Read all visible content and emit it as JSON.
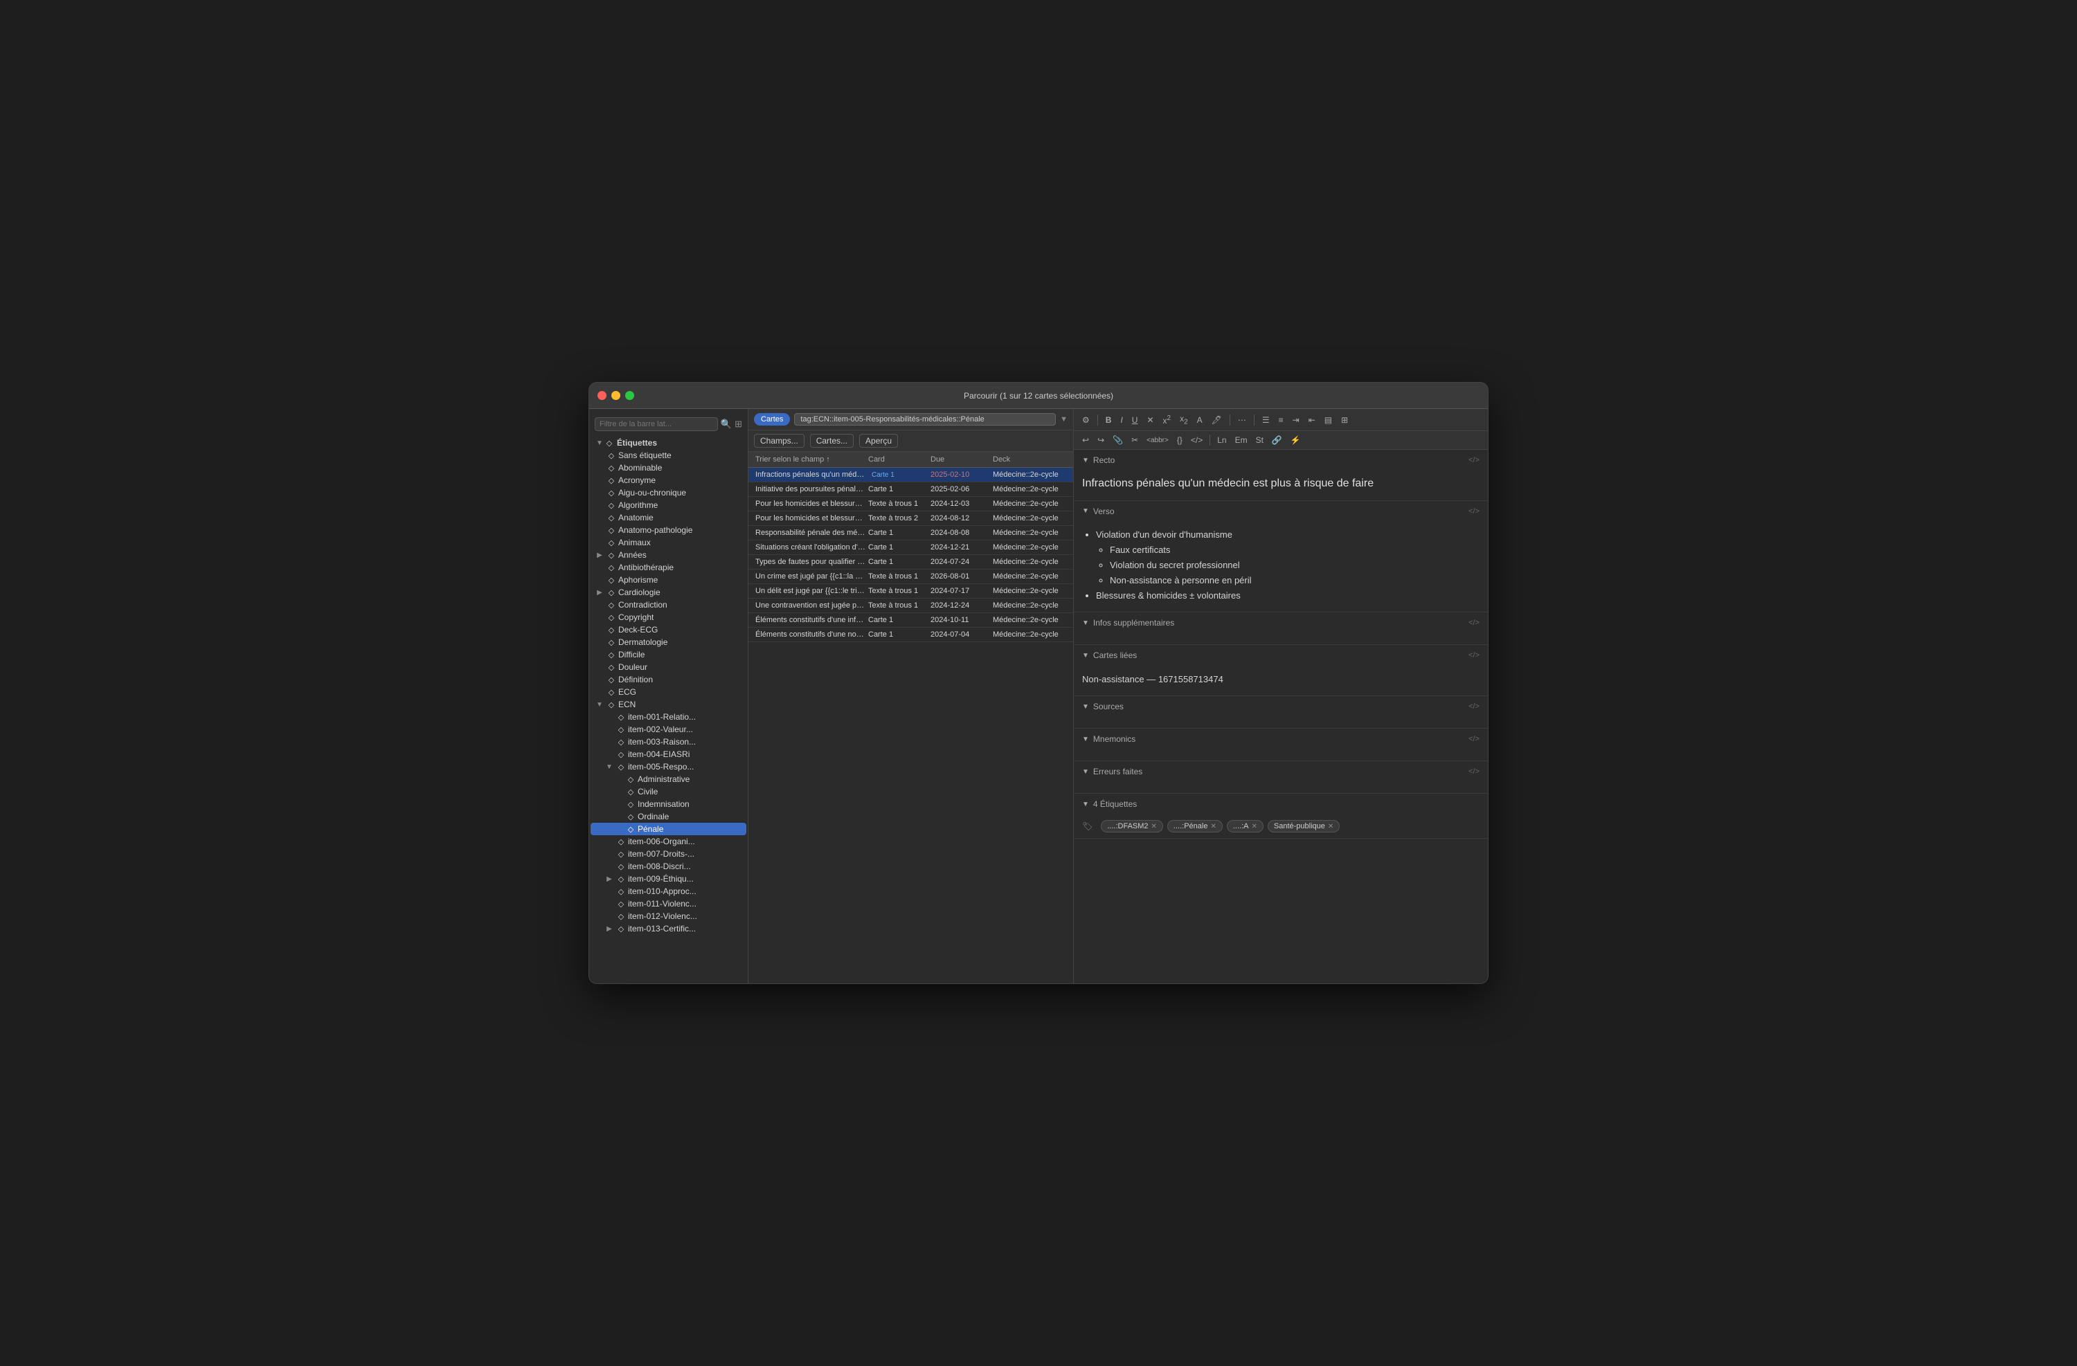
{
  "window": {
    "title": "Parcourir (1 sur 12 cartes sélectionnées)"
  },
  "toolbar": {
    "filter_placeholder": "Filtre de la barre lat...",
    "cards_btn": "Cartes",
    "tag_filter": "tag:ECN::item-005-Responsabilités-médicales::Pénale",
    "champs_btn": "Champs...",
    "cartes_btn": "Cartes...",
    "apercu_btn": "Aperçu"
  },
  "table": {
    "headers": [
      "Trier selon le champ",
      "Card",
      "Due",
      "Deck"
    ],
    "rows": [
      {
        "title": "Infractions pénales qu'un médeci...",
        "card": "Carte 1",
        "due": "2025-02-10",
        "deck": "Médecine::2e-cycle",
        "selected": true
      },
      {
        "title": "Initiative des poursuites pénales ...",
        "card": "Carte 1",
        "due": "2025-02-06",
        "deck": "Médecine::2e-cycle",
        "selected": false
      },
      {
        "title": "Pour les homicides et blessures i...",
        "card": "Texte à trous 1",
        "due": "2024-12-03",
        "deck": "Médecine::2e-cycle",
        "selected": false
      },
      {
        "title": "Pour les homicides et blessures i...",
        "card": "Texte à trous 2",
        "due": "2024-08-12",
        "deck": "Médecine::2e-cycle",
        "selected": false
      },
      {
        "title": "Responsabilité pénale des méde...",
        "card": "Carte 1",
        "due": "2024-08-08",
        "deck": "Médecine::2e-cycle",
        "selected": false
      },
      {
        "title": "Situations créant l'obligation d'as...",
        "card": "Carte 1",
        "due": "2024-12-21",
        "deck": "Médecine::2e-cycle",
        "selected": false
      },
      {
        "title": "Types de fautes pour qualifier un...",
        "card": "Carte 1",
        "due": "2024-07-24",
        "deck": "Médecine::2e-cycle",
        "selected": false
      },
      {
        "title": "Un crime est jugé par {{c1::la cou...",
        "card": "Texte à trous 1",
        "due": "2026-08-01",
        "deck": "Médecine::2e-cycle",
        "selected": false
      },
      {
        "title": "Un délit est jugé par {{c1::le tribu...",
        "card": "Texte à trous 1",
        "due": "2024-07-17",
        "deck": "Médecine::2e-cycle",
        "selected": false
      },
      {
        "title": "Une contravention est jugée par ...",
        "card": "Texte à trous 1",
        "due": "2024-12-24",
        "deck": "Médecine::2e-cycle",
        "selected": false
      },
      {
        "title": "Éléments constitutifs d'une infrac...",
        "card": "Carte 1",
        "due": "2024-10-11",
        "deck": "Médecine::2e-cycle",
        "selected": false
      },
      {
        "title": "Éléments constitutifs d'une non-a...",
        "card": "Carte 1",
        "due": "2024-07-04",
        "deck": "Médecine::2e-cycle",
        "selected": false
      }
    ]
  },
  "sidebar": {
    "filter_placeholder": "Filtre de la barre lat...",
    "root_label": "Étiquettes",
    "items": [
      {
        "label": "Sans étiquette",
        "depth": 1,
        "arrow": "",
        "icon": "◇"
      },
      {
        "label": "Abominable",
        "depth": 1,
        "arrow": "",
        "icon": "◇"
      },
      {
        "label": "Acronyme",
        "depth": 1,
        "arrow": "",
        "icon": "◇"
      },
      {
        "label": "Aigu-ou-chronique",
        "depth": 1,
        "arrow": "",
        "icon": "◇"
      },
      {
        "label": "Algorithme",
        "depth": 1,
        "arrow": "",
        "icon": "◇"
      },
      {
        "label": "Anatomie",
        "depth": 1,
        "arrow": "",
        "icon": "◇"
      },
      {
        "label": "Anatomo-pathologie",
        "depth": 1,
        "arrow": "",
        "icon": "◇"
      },
      {
        "label": "Animaux",
        "depth": 1,
        "arrow": "",
        "icon": "◇"
      },
      {
        "label": "Années",
        "depth": 1,
        "arrow": "▶",
        "icon": "◇"
      },
      {
        "label": "Antibiothérapie",
        "depth": 1,
        "arrow": "",
        "icon": "◇"
      },
      {
        "label": "Aphorisme",
        "depth": 1,
        "arrow": "",
        "icon": "◇"
      },
      {
        "label": "Cardiologie",
        "depth": 1,
        "arrow": "▶",
        "icon": "◇"
      },
      {
        "label": "Contradiction",
        "depth": 1,
        "arrow": "",
        "icon": "◇"
      },
      {
        "label": "Copyright",
        "depth": 1,
        "arrow": "",
        "icon": "◇"
      },
      {
        "label": "Deck-ECG",
        "depth": 1,
        "arrow": "",
        "icon": "◇"
      },
      {
        "label": "Dermatologie",
        "depth": 1,
        "arrow": "",
        "icon": "◇"
      },
      {
        "label": "Difficile",
        "depth": 1,
        "arrow": "",
        "icon": "◇"
      },
      {
        "label": "Douleur",
        "depth": 1,
        "arrow": "",
        "icon": "◇"
      },
      {
        "label": "Définition",
        "depth": 1,
        "arrow": "",
        "icon": "◇"
      },
      {
        "label": "ECG",
        "depth": 1,
        "arrow": "",
        "icon": "◇"
      },
      {
        "label": "ECN",
        "depth": 1,
        "arrow": "▼",
        "icon": "◇"
      },
      {
        "label": "item-001-Relatio...",
        "depth": 2,
        "arrow": "",
        "icon": "◇"
      },
      {
        "label": "item-002-Valeur...",
        "depth": 2,
        "arrow": "",
        "icon": "◇"
      },
      {
        "label": "item-003-Raison...",
        "depth": 2,
        "arrow": "",
        "icon": "◇"
      },
      {
        "label": "item-004-EIASRi",
        "depth": 2,
        "arrow": "",
        "icon": "◇"
      },
      {
        "label": "item-005-Respo...",
        "depth": 2,
        "arrow": "▼",
        "icon": "◇"
      },
      {
        "label": "Administrative",
        "depth": 3,
        "arrow": "",
        "icon": "◇"
      },
      {
        "label": "Civile",
        "depth": 3,
        "arrow": "",
        "icon": "◇"
      },
      {
        "label": "Indemnisation",
        "depth": 3,
        "arrow": "",
        "icon": "◇"
      },
      {
        "label": "Ordinale",
        "depth": 3,
        "arrow": "",
        "icon": "◇"
      },
      {
        "label": "Pénale",
        "depth": 3,
        "arrow": "",
        "icon": "◇",
        "selected": true
      },
      {
        "label": "item-006-Organi...",
        "depth": 2,
        "arrow": "",
        "icon": "◇"
      },
      {
        "label": "item-007-Droits-...",
        "depth": 2,
        "arrow": "",
        "icon": "◇"
      },
      {
        "label": "item-008-Discri...",
        "depth": 2,
        "arrow": "",
        "icon": "◇"
      },
      {
        "label": "item-009-Éthiqu...",
        "depth": 2,
        "arrow": "▶",
        "icon": "◇"
      },
      {
        "label": "item-010-Approc...",
        "depth": 2,
        "arrow": "",
        "icon": "◇"
      },
      {
        "label": "item-011-Violenc...",
        "depth": 2,
        "arrow": "",
        "icon": "◇"
      },
      {
        "label": "item-012-Violenc...",
        "depth": 2,
        "arrow": "",
        "icon": "◇"
      },
      {
        "label": "item-013-Certific...",
        "depth": 2,
        "arrow": "▶",
        "icon": "◇"
      }
    ]
  },
  "card": {
    "recto_label": "Recto",
    "recto_text": "Infractions pénales qu'un médecin est plus à risque de faire",
    "verso_label": "Verso",
    "verso_items": [
      {
        "text": "Violation d'un devoir d'humanisme",
        "level": 1
      },
      {
        "text": "Faux certificats",
        "level": 2
      },
      {
        "text": "Violation du secret professionnel",
        "level": 2
      },
      {
        "text": "Non-assistance à personne en péril",
        "level": 2
      },
      {
        "text": "Blessures & homicides ± volontaires",
        "level": 1
      }
    ],
    "infos_label": "Infos supplémentaires",
    "cartes_liees_label": "Cartes liées",
    "linked_card": "Non-assistance — 1671558713474",
    "sources_label": "Sources",
    "mnemonics_label": "Mnemonics",
    "erreurs_label": "Erreurs faites",
    "etiquettes_label": "4 Étiquettes",
    "tags": [
      {
        "label": "....:DFASM2",
        "removable": true
      },
      {
        "label": "....:Pénale",
        "removable": true
      },
      {
        "label": "....:A",
        "removable": true
      },
      {
        "label": "Santé-publique",
        "removable": true
      }
    ]
  },
  "toolbar_buttons": {
    "bold": "B",
    "italic": "I",
    "underline": "U",
    "strikethrough": "✕",
    "abbr": "<abbr>",
    "code_braces": "{}",
    "code_angle": "</>",
    "gear": "⚙"
  }
}
